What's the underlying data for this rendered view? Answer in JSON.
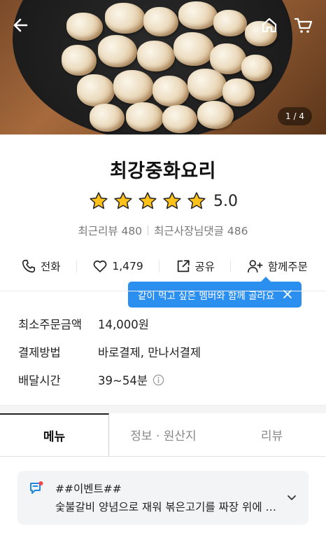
{
  "hero": {
    "page_indicator": "1 / 4",
    "icons": [
      "back-arrow-icon",
      "home-icon",
      "cart-icon"
    ]
  },
  "store": {
    "name": "최강중화요리",
    "rating": 5.0,
    "rating_text": "5.0",
    "stars_filled": 5,
    "recent_reviews": "최근리뷰 480",
    "recent_owner_replies": "최근사장님댓글 486"
  },
  "actions": {
    "call": "전화",
    "likes": "1,479",
    "share": "공유",
    "group_order": "함께주문"
  },
  "tooltip": {
    "text": "같이 먹고 싶은 멤버와 함께 골라요"
  },
  "info": {
    "min_order_label": "최소주문금액",
    "min_order_value": "14,000원",
    "payment_label": "결제방법",
    "payment_value": "바로결제, 만나서결제",
    "delivery_label": "배달시간",
    "delivery_value": "39~54분"
  },
  "tabs": [
    {
      "label": "메뉴",
      "active": true
    },
    {
      "label": "정보 · 원산지",
      "active": false
    },
    {
      "label": "리뷰",
      "active": false
    }
  ],
  "notice": {
    "title": "##이벤트##",
    "text": "숯불갈비 양념으로 재워 볶은고기를 짜장 위에 올린"
  },
  "colors": {
    "accent_blue": "#2b8ff0",
    "star_yellow": "#ffc21a",
    "notice_icon_blue": "#1e88e5",
    "notice_dot_red": "#f04452"
  }
}
